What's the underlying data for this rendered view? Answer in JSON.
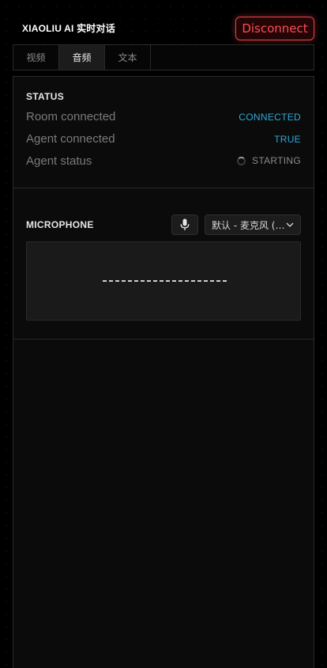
{
  "header": {
    "title": "XIAOLIU AI 实时对话",
    "disconnect_label": "Disconnect"
  },
  "tabs": [
    {
      "label": "视频",
      "active": false
    },
    {
      "label": "音频",
      "active": true
    },
    {
      "label": "文本",
      "active": false
    }
  ],
  "status": {
    "heading": "STATUS",
    "rows": [
      {
        "label": "Room connected",
        "value": "CONNECTED"
      },
      {
        "label": "Agent connected",
        "value": "TRUE"
      },
      {
        "label": "Agent status",
        "value": "STARTING"
      }
    ]
  },
  "microphone": {
    "heading": "MICROPHONE",
    "device_label": "默认 - 麦克风 (Realtek(R) Audio)",
    "bar_count": 20
  },
  "colors": {
    "accent_blue": "#2ca9d9",
    "danger_red": "#e8434a"
  }
}
